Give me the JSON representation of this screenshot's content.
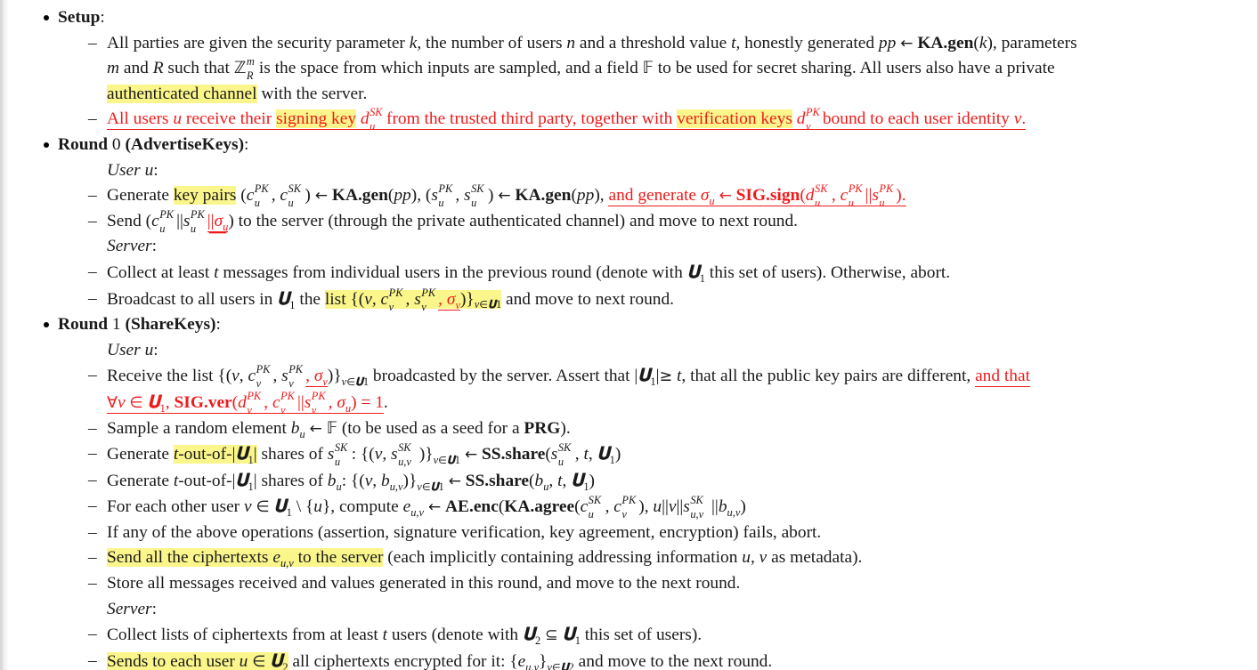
{
  "document": {
    "type": "academic-paper-excerpt",
    "topic": "Secure aggregation protocol with signature-based authentication",
    "background_color": "#ffffff",
    "text_color": "#1a1a1a",
    "highlight_color": "#fbf68b",
    "annotation_color": "#ee1b1b"
  },
  "sections": [
    {
      "id": "setup",
      "heading": "Setup",
      "heading_suffix": ":",
      "items": [
        {
          "id": "setup-item-1",
          "style": "normal",
          "text": "All parties are given the security parameter k, the number of users n and a threshold value t, honestly generated pp ← KA.gen(k), parameters m and R such that Z_R^m is the space from which inputs are sampled, and a field F to be used for secret sharing. All users also have a private authenticated channel with the server.",
          "highlight": "authenticated channel"
        },
        {
          "id": "setup-item-2",
          "style": "red-underline",
          "text": "All users u receive their signing key d_u^SK from the trusted third party, together with verification keys d_v^PK bound to each user identity v.",
          "highlight": [
            "signing key",
            "verification keys"
          ]
        }
      ]
    },
    {
      "id": "round-0",
      "heading": "Round 0 (AdvertiseKeys)",
      "heading_prefix": "Round",
      "heading_number": "0",
      "heading_name": "(AdvertiseKeys)",
      "heading_suffix": ":",
      "roles": [
        {
          "id": "round-0-user",
          "label": "User u",
          "label_suffix": ":",
          "items": [
            {
              "id": "r0-user-1",
              "text": "Generate key pairs (c_u^PK, c_u^SK) ← KA.gen(pp), (s_u^PK, s_u^SK) ← KA.gen(pp), and generate σ_u ← SIG.sign(d_u^SK, c_u^PK||s_u^PK).",
              "highlight": "key pairs",
              "red_part": "and generate σ_u ← SIG.sign(d_u^SK, c_u^PK||s_u^PK)."
            },
            {
              "id": "r0-user-2",
              "text": "Send (c_u^PK||s_u^PK ||σ_u) to the server (through the private authenticated channel) and move to next round.",
              "red_part": "||σ_u"
            }
          ]
        },
        {
          "id": "round-0-server",
          "label": "Server",
          "label_suffix": ":",
          "items": [
            {
              "id": "r0-server-1",
              "text": "Collect at least t messages from individual users in the previous round (denote with U_1 this set of users). Otherwise, abort."
            },
            {
              "id": "r0-server-2",
              "text": "Broadcast to all users in U_1 the list {(v, c_v^PK, s_v^PK, σ_v)}_{v∈U_1} and move to next round.",
              "highlight": "list {(v, c_v^PK, s_v^PK, σ_v)}_{v∈U_1}",
              "red_part": ", σ_v"
            }
          ]
        }
      ]
    },
    {
      "id": "round-1",
      "heading": "Round 1 (ShareKeys)",
      "heading_prefix": "Round",
      "heading_number": "1",
      "heading_name": "(ShareKeys)",
      "heading_suffix": ":",
      "roles": [
        {
          "id": "round-1-user",
          "label": "User u",
          "label_suffix": ":",
          "items": [
            {
              "id": "r1-user-1",
              "text": "Receive the list {(v, c_v^PK, s_v^PK, σ_v)}_{v∈U_1} broadcasted by the server. Assert that |U_1| ≥ t, that all the public key pairs are different, and that ∀v ∈ U_1, SIG.ver(d_v^PK, c_v^PK||s_v^PK, σ_u) = 1.",
              "red_part": "and that ∀v ∈ U_1, SIG.ver(d_v^PK, c_v^PK||s_v^PK, σ_u) = 1."
            },
            {
              "id": "r1-user-2",
              "text": "Sample a random element b_u ← F (to be used as a seed for a PRG)."
            },
            {
              "id": "r1-user-3",
              "text": "Generate t-out-of-|U_1| shares of s_u^SK: {(v, s_{u,v}^SK)}_{v∈U_1} ← SS.share(s_u^SK, t, U_1)",
              "highlight": "t-out-of-|U_1|"
            },
            {
              "id": "r1-user-4",
              "text": "Generate t-out-of-|U_1| shares of b_u: {(v, b_{u,v})}_{v∈U_1} ← SS.share(b_u, t, U_1)"
            },
            {
              "id": "r1-user-5",
              "text": "For each other user v ∈ U_1 \\ {u}, compute e_{u,v} ← AE.enc(KA.agree(c_u^SK, c_v^PK), u||v||s_{u,v}^SK||b_{u,v})"
            },
            {
              "id": "r1-user-6",
              "text": "If any of the above operations (assertion, signature verification, key agreement, encryption) fails, abort."
            },
            {
              "id": "r1-user-7",
              "text": "Send all the ciphertexts e_{u,v} to the server (each implicitly containing addressing information u, v as metadata).",
              "highlight": "Send all the ciphertexts e_{u,v} to the server"
            },
            {
              "id": "r1-user-8",
              "text": "Store all messages received and values generated in this round, and move to the next round."
            }
          ]
        },
        {
          "id": "round-1-server",
          "label": "Server",
          "label_suffix": ":",
          "items": [
            {
              "id": "r1-server-1",
              "text": "Collect lists of ciphertexts from at least t users (denote with U_2 ⊆ U_1 this set of users)."
            },
            {
              "id": "r1-server-2",
              "text": "Sends to each user u ∈ U_2 all ciphertexts encrypted for it: {e_{u,v}}_{v∈U_2} and move to the next round.",
              "highlight": "Sends to each user u ∈ U_2"
            }
          ]
        }
      ]
    }
  ],
  "labels": {
    "setup_heading": "Setup",
    "colon": ":",
    "round_word": "Round",
    "round0_number": "0",
    "round0_name": "(AdvertiseKeys)",
    "round1_number": "1",
    "round1_name": "(ShareKeys)",
    "user_role": "User",
    "user_var": "u",
    "server_role": "Server",
    "dash": "–"
  }
}
